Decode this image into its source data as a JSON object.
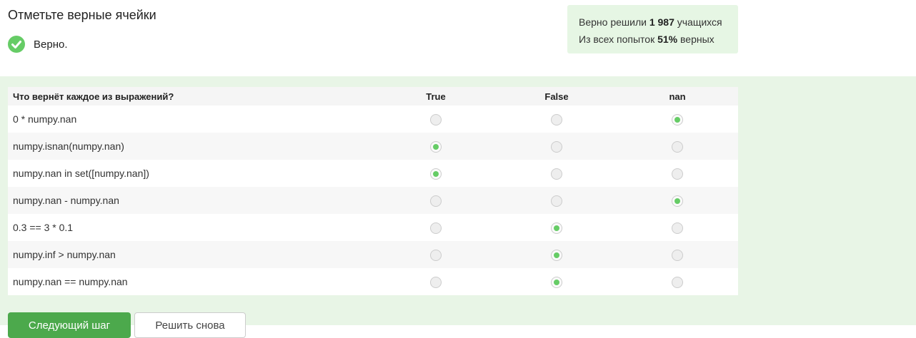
{
  "task": {
    "title": "Отметьте верные ячейки",
    "verdict": "Верно."
  },
  "stats": {
    "solved_prefix": "Верно решили",
    "solved_count": "1 987",
    "solved_suffix": "учащихся",
    "attempts_prefix": "Из всех попыток",
    "attempts_percent": "51%",
    "attempts_suffix": "верных"
  },
  "matrix": {
    "question_header": "Что вернёт каждое из выражений?",
    "columns": [
      "True",
      "False",
      "nan"
    ],
    "rows": [
      {
        "label": "0 * numpy.nan",
        "selected": 2
      },
      {
        "label": "numpy.isnan(numpy.nan)",
        "selected": 0
      },
      {
        "label": "numpy.nan in set([numpy.nan])",
        "selected": 0
      },
      {
        "label": "numpy.nan - numpy.nan",
        "selected": 2
      },
      {
        "label": "0.3 == 3 * 0.1",
        "selected": 1
      },
      {
        "label": "numpy.inf > numpy.nan",
        "selected": 1
      },
      {
        "label": "numpy.nan == numpy.nan",
        "selected": 1
      }
    ]
  },
  "buttons": {
    "next": "Следующий шаг",
    "retry": "Решить снова"
  },
  "colors": {
    "accent": "#66cc66",
    "button_green": "#4ca94c",
    "stats_bg": "#e6f6e4",
    "area_bg": "#e8f5e6"
  }
}
